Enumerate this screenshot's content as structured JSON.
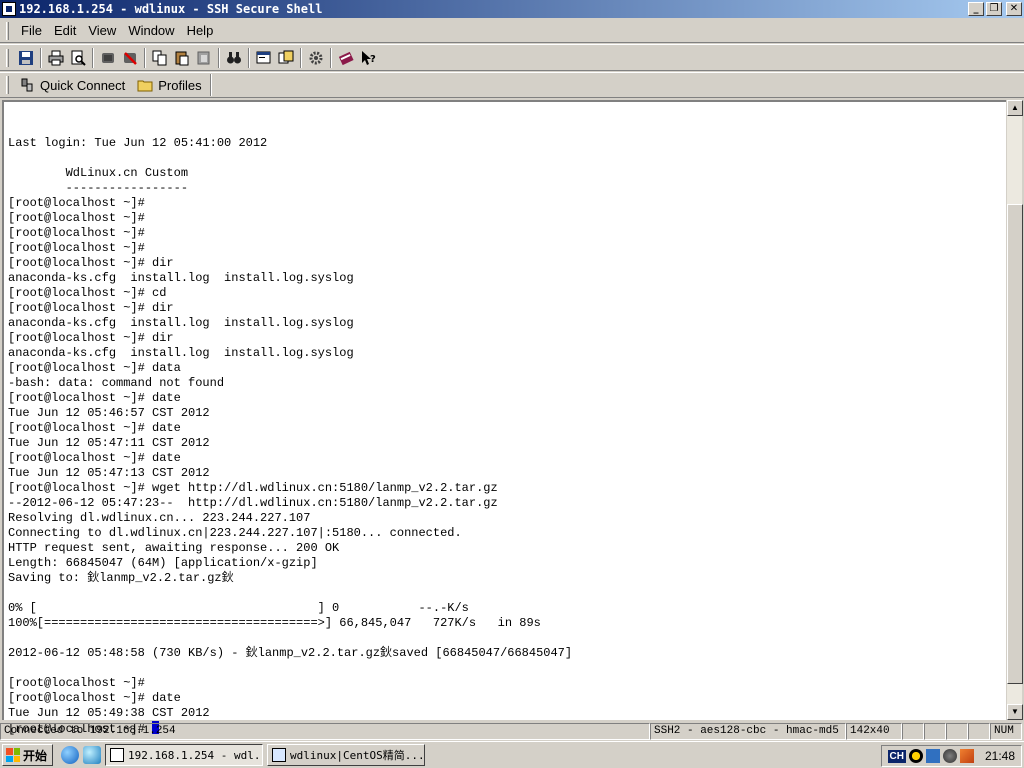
{
  "window": {
    "title": "192.168.1.254 - wdlinux - SSH Secure Shell",
    "controls": {
      "minimize": "_",
      "restore": "❐",
      "close": "✕"
    }
  },
  "menu": [
    {
      "label": "File"
    },
    {
      "label": "Edit"
    },
    {
      "label": "View"
    },
    {
      "label": "Window"
    },
    {
      "label": "Help"
    }
  ],
  "toolbar": {
    "icons": [
      "save-icon",
      "print-icon",
      "print-preview-icon",
      "disconnect-icon",
      "reconnect-icon",
      "copy-icon",
      "paste-icon",
      "paste-special-icon",
      "find-icon",
      "new-terminal-icon",
      "new-file-transfer-icon",
      "settings-icon",
      "profiles-icon",
      "help-icon"
    ]
  },
  "connect_bar": {
    "quick_connect": "Quick Connect",
    "profiles": "Profiles"
  },
  "terminal": {
    "lines": [
      "Last login: Tue Jun 12 05:41:00 2012",
      "",
      "        WdLinux.cn Custom",
      "        -----------------",
      "[root@localhost ~]#",
      "[root@localhost ~]#",
      "[root@localhost ~]#",
      "[root@localhost ~]#",
      "[root@localhost ~]# dir",
      "anaconda-ks.cfg  install.log  install.log.syslog",
      "[root@localhost ~]# cd",
      "[root@localhost ~]# dir",
      "anaconda-ks.cfg  install.log  install.log.syslog",
      "[root@localhost ~]# dir",
      "anaconda-ks.cfg  install.log  install.log.syslog",
      "[root@localhost ~]# data",
      "-bash: data: command not found",
      "[root@localhost ~]# date",
      "Tue Jun 12 05:46:57 CST 2012",
      "[root@localhost ~]# date",
      "Tue Jun 12 05:47:11 CST 2012",
      "[root@localhost ~]# date",
      "Tue Jun 12 05:47:13 CST 2012",
      "[root@localhost ~]# wget http://dl.wdlinux.cn:5180/lanmp_v2.2.tar.gz",
      "--2012-06-12 05:47:23--  http://dl.wdlinux.cn:5180/lanmp_v2.2.tar.gz",
      "Resolving dl.wdlinux.cn... 223.244.227.107",
      "Connecting to dl.wdlinux.cn|223.244.227.107|:5180... connected.",
      "HTTP request sent, awaiting response... 200 OK",
      "Length: 66845047 (64M) [application/x-gzip]",
      "Saving to: 鈥lanmp_v2.2.tar.gz鈥",
      "",
      "0% [                                       ] 0           --.-K/s",
      "100%[======================================>] 66,845,047   727K/s   in 89s",
      "",
      "2012-06-12 05:48:58 (730 KB/s) - 鈥lanmp_v2.2.tar.gz鈥saved [66845047/66845047]",
      "",
      "[root@localhost ~]#",
      "[root@localhost ~]# date",
      "Tue Jun 12 05:49:38 CST 2012"
    ],
    "prompt": "[root@localhost ~]# "
  },
  "status": {
    "connection": "Connected to 192.168.1.254",
    "cipher": "SSH2 - aes128-cbc - hmac-md5 - :",
    "size": "142x40",
    "num": "NUM"
  },
  "taskbar": {
    "start": "开始",
    "tasks": [
      {
        "label": "192.168.1.254 - wdl...",
        "active": true
      },
      {
        "label": "wdlinux|CentOS精简...",
        "active": false
      }
    ],
    "tray": {
      "ime": "CH",
      "clock": "21:48"
    }
  }
}
